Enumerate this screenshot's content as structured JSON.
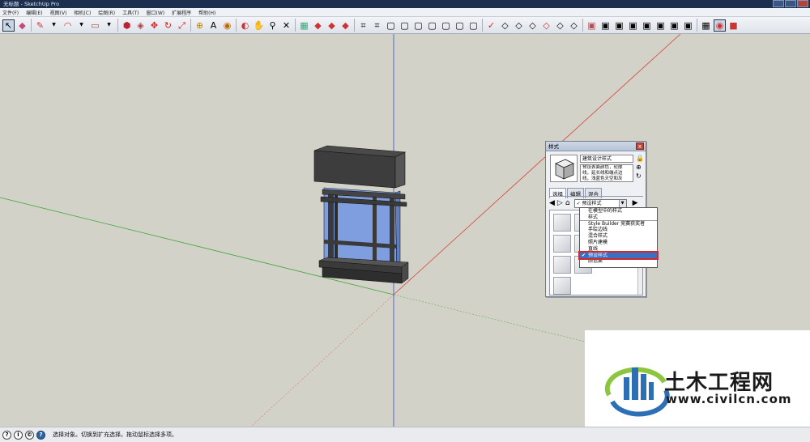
{
  "window": {
    "title": "无标题 - SketchUp Pro"
  },
  "menu": [
    "文件(F)",
    "编辑(E)",
    "视图(V)",
    "相机(C)",
    "绘图(R)",
    "工具(T)",
    "窗口(W)",
    "扩展程序",
    "帮助(H)"
  ],
  "status": {
    "text": "选择对象。切换到扩充选择。拖动鼠标选择多项。"
  },
  "styles_panel": {
    "title": "样式",
    "close_label": "x",
    "style_name": "建筑设计样式",
    "style_desc": "预设表面颜色，轮廓线，延长线和端点边线，浅蓝色天空和灰",
    "tabs": [
      "选择",
      "编辑",
      "混合"
    ],
    "combo_value": "✓ 预设样式"
  },
  "dropdown": {
    "items": [
      "在模型中的样式",
      "样式",
      "Style Builder 竞赛获奖者",
      "手绘边线",
      "混合样式",
      "照片建模",
      "直线",
      "预设样式",
      "颜色集"
    ],
    "selected_index": 7
  },
  "watermark": {
    "title": "土木工程网",
    "url": "www.civilcn.com"
  },
  "colors": {
    "red_axis": "#d9403a",
    "green_axis": "#3fa63a",
    "blue_axis": "#3a4fc7",
    "glass": "#7f9ee0",
    "frame": "#2e2e2e"
  }
}
